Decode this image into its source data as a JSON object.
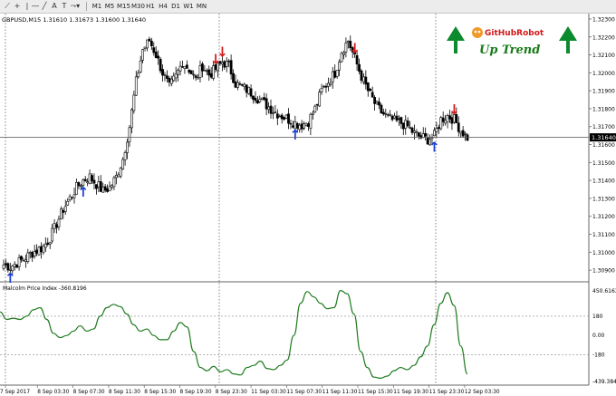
{
  "toolbar": {
    "tools": [
      {
        "name": "line-tool-icon",
        "glyph": "⟋"
      },
      {
        "name": "crosshair-icon",
        "glyph": "+"
      },
      {
        "name": "vertical-line-icon",
        "glyph": "|"
      },
      {
        "name": "horizontal-line-icon",
        "glyph": "―"
      },
      {
        "name": "trendline-icon",
        "glyph": "╱"
      },
      {
        "name": "text-tool-icon",
        "glyph": "A"
      },
      {
        "name": "text-label-icon",
        "glyph": "T"
      },
      {
        "name": "shapes-dropdown-icon",
        "glyph": "⤳▾"
      }
    ],
    "timeframes": [
      {
        "label": "M1",
        "active": false
      },
      {
        "label": "M5",
        "active": false
      },
      {
        "label": "M15",
        "active": false
      },
      {
        "label": "M30",
        "active": false
      },
      {
        "label": "H1",
        "active": false
      },
      {
        "label": "H4",
        "active": false
      },
      {
        "label": "D1",
        "active": false
      },
      {
        "label": "W1",
        "active": false
      },
      {
        "label": "MN",
        "active": false
      }
    ]
  },
  "chart": {
    "header": "GBPUSD,M15  1.31610 1.31673 1.31600 1.31640",
    "current_price": "1.31640",
    "price_ticks": [
      "1.32300",
      "1.32200",
      "1.32100",
      "1.32000",
      "1.31900",
      "1.31800",
      "1.31700",
      "1.31600",
      "1.31500",
      "1.31400",
      "1.31300",
      "1.31200",
      "1.31100",
      "1.31000",
      "1.30900"
    ],
    "time_labels": [
      "7 Sep 2017",
      "8 Sep 03:30",
      "8 Sep 07:30",
      "8 Sep 11:30",
      "8 Sep 15:30",
      "8 Sep 19:30",
      "8 Sep 23:30",
      "11 Sep 03:30",
      "11 Sep 07:30",
      "11 Sep 11:30",
      "11 Sep 15:30",
      "11 Sep 19:30",
      "11 Sep 23:30",
      "12 Sep 03:30"
    ],
    "logo": {
      "brand": "GitHubRobot",
      "subtitle": "Up Trend"
    },
    "colors": {
      "candle": "#000000",
      "up_arrow": "#1a3fd1",
      "down_arrow": "#d81818",
      "indicator": "#1f7a1f",
      "logo_arrow": "#0c8a2e",
      "logo_text": "#1a7a1a",
      "brand_text": "#d01a1a"
    },
    "up_arrow_glyph": "↑",
    "down_arrow_glyph": "↓"
  },
  "indicator": {
    "title": "Malcolm Price Index -360.8196",
    "ticks": [
      "450.6163",
      "180",
      "0.00",
      "-180",
      "-439.3844"
    ]
  },
  "chart_data": {
    "type": "candlestick",
    "symbol": "GBPUSD",
    "timeframe": "M15",
    "ylim": [
      1.3085,
      1.3232
    ],
    "price_path": [
      1.3093,
      1.3092,
      1.3094,
      1.3096,
      1.3099,
      1.3101,
      1.3103,
      1.3108,
      1.3116,
      1.3124,
      1.313,
      1.3136,
      1.314,
      1.3142,
      1.3138,
      1.3134,
      1.3136,
      1.3142,
      1.3152,
      1.317,
      1.3195,
      1.3213,
      1.3218,
      1.321,
      1.32,
      1.3192,
      1.3198,
      1.3206,
      1.3202,
      1.3196,
      1.3204,
      1.3199,
      1.3202,
      1.3206,
      1.3204,
      1.3194,
      1.3192,
      1.319,
      1.3187,
      1.3184,
      1.3181,
      1.3178,
      1.3176,
      1.3174,
      1.3172,
      1.3171,
      1.3173,
      1.318,
      1.319,
      1.3195,
      1.32,
      1.3212,
      1.3218,
      1.3208,
      1.3198,
      1.319,
      1.3183,
      1.3178,
      1.3175,
      1.3173,
      1.3172,
      1.317,
      1.3166,
      1.3164,
      1.3163,
      1.3165,
      1.3174,
      1.3176,
      1.3174,
      1.3168,
      1.3164
    ],
    "signals": [
      {
        "type": "buy",
        "index": 12
      },
      {
        "type": "buy",
        "index": 1
      },
      {
        "type": "sell",
        "index": 32
      },
      {
        "type": "sell",
        "index": 33
      },
      {
        "type": "buy",
        "index": 44
      },
      {
        "type": "sell",
        "index": 53
      },
      {
        "type": "buy",
        "index": 65
      },
      {
        "type": "sell",
        "index": 68
      }
    ],
    "indicator": {
      "name": "Malcolm Price Index",
      "last_value": -360.8196,
      "ylim": [
        -439.3844,
        450.6163
      ],
      "values": [
        220,
        150,
        160,
        150,
        180,
        240,
        260,
        150,
        20,
        -20,
        0,
        40,
        90,
        40,
        60,
        180,
        260,
        290,
        270,
        200,
        100,
        40,
        60,
        0,
        -40,
        -40,
        40,
        120,
        80,
        -150,
        -300,
        -330,
        -290,
        -340,
        -320,
        -360,
        -370,
        -300,
        -280,
        -240,
        -310,
        -320,
        -280,
        -230,
        0,
        300,
        410,
        360,
        300,
        250,
        260,
        420,
        390,
        200,
        -150,
        -300,
        -390,
        -400,
        -380,
        -330,
        -300,
        -320,
        -280,
        -200,
        -100,
        100,
        300,
        400,
        280,
        -100,
        -360
      ]
    }
  }
}
